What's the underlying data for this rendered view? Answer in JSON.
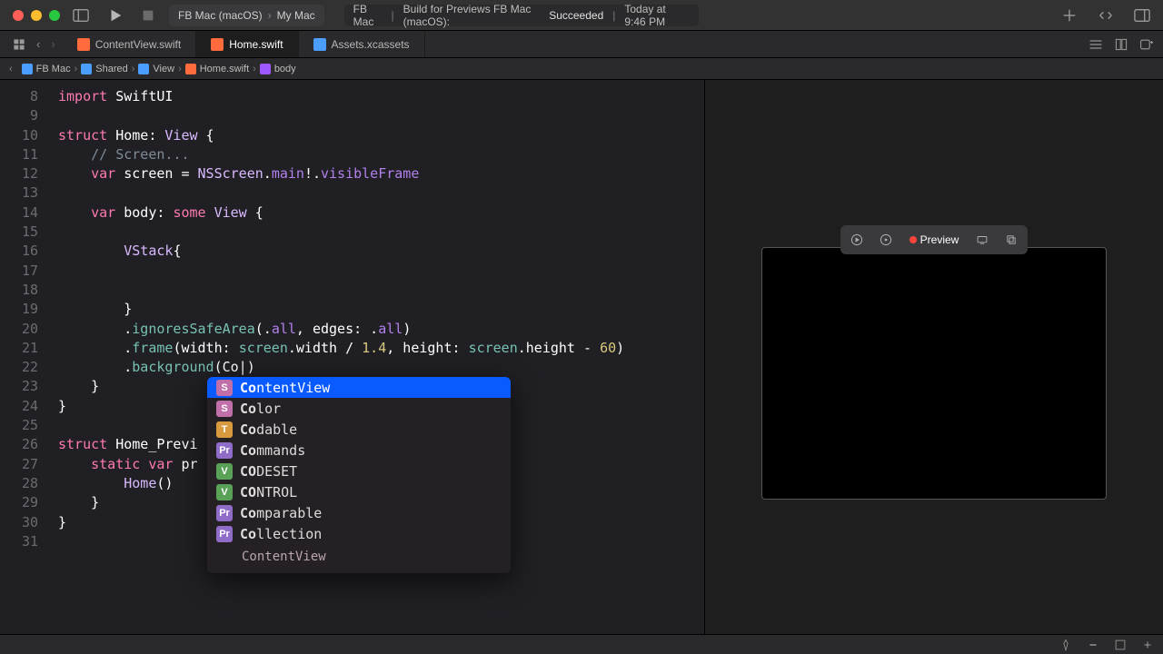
{
  "titlebar": {
    "scheme_target": "FB Mac (macOS)",
    "scheme_device": "My Mac",
    "status_prefix": "FB Mac",
    "status_action": "Build for Previews FB Mac (macOS):",
    "status_result": "Succeeded",
    "status_time": "Today at 9:46 PM"
  },
  "tabs": [
    {
      "label": "ContentView.swift",
      "active": false,
      "kind": "swift"
    },
    {
      "label": "Home.swift",
      "active": true,
      "kind": "swift"
    },
    {
      "label": "Assets.xcassets",
      "active": false,
      "kind": "asset"
    }
  ],
  "breadcrumb": [
    {
      "label": "FB Mac",
      "icon": "proj"
    },
    {
      "label": "Shared",
      "icon": "folder"
    },
    {
      "label": "View",
      "icon": "folder"
    },
    {
      "label": "Home.swift",
      "icon": "file"
    },
    {
      "label": "body",
      "icon": "prop"
    }
  ],
  "editor": {
    "first_line": 8,
    "lines": [
      {
        "t": "import SwiftUI",
        "spans": [
          [
            "import",
            "kw"
          ],
          [
            " ",
            "plain"
          ],
          [
            "SwiftUI",
            "plain"
          ]
        ]
      },
      {
        "t": "",
        "spans": []
      },
      {
        "t": "struct Home: View {",
        "spans": [
          [
            "struct",
            "kw"
          ],
          [
            " Home: ",
            "plain"
          ],
          [
            "View",
            "type"
          ],
          [
            " {",
            "plain"
          ]
        ]
      },
      {
        "t": "    // Screen...",
        "spans": [
          [
            "    ",
            "plain"
          ],
          [
            "// Screen...",
            "cmt"
          ]
        ]
      },
      {
        "t": "    var screen = NSScreen.main!.visibleFrame",
        "spans": [
          [
            "    ",
            "plain"
          ],
          [
            "var",
            "kw"
          ],
          [
            " screen = ",
            "plain"
          ],
          [
            "NSScreen",
            "type"
          ],
          [
            ".",
            "plain"
          ],
          [
            "main",
            "method"
          ],
          [
            "!.",
            "plain"
          ],
          [
            "visibleFrame",
            "method"
          ]
        ]
      },
      {
        "t": "",
        "spans": []
      },
      {
        "t": "    var body: some View {",
        "spans": [
          [
            "    ",
            "plain"
          ],
          [
            "var",
            "kw"
          ],
          [
            " body: ",
            "plain"
          ],
          [
            "some",
            "kw"
          ],
          [
            " ",
            "plain"
          ],
          [
            "View",
            "type"
          ],
          [
            " {",
            "plain"
          ]
        ]
      },
      {
        "t": "",
        "spans": []
      },
      {
        "t": "        VStack{",
        "spans": [
          [
            "        ",
            "plain"
          ],
          [
            "VStack",
            "type"
          ],
          [
            "{",
            "plain"
          ]
        ]
      },
      {
        "t": "",
        "spans": []
      },
      {
        "t": "",
        "spans": []
      },
      {
        "t": "        }",
        "spans": [
          [
            "        }",
            "plain"
          ]
        ]
      },
      {
        "t": "        .ignoresSafeArea(.all, edges: .all)",
        "spans": [
          [
            "        .",
            "plain"
          ],
          [
            "ignoresSafeArea",
            "prop"
          ],
          [
            "(.",
            "plain"
          ],
          [
            "all",
            "method"
          ],
          [
            ", edges: .",
            "plain"
          ],
          [
            "all",
            "method"
          ],
          [
            ")",
            "plain"
          ]
        ]
      },
      {
        "t": "        .frame(width: screen.width / 1.4, height: screen.height - 60)",
        "spans": [
          [
            "        .",
            "plain"
          ],
          [
            "frame",
            "prop"
          ],
          [
            "(width: ",
            "plain"
          ],
          [
            "screen",
            "prop"
          ],
          [
            ".width / ",
            "plain"
          ],
          [
            "1.4",
            "num"
          ],
          [
            ", height: ",
            "plain"
          ],
          [
            "screen",
            "prop"
          ],
          [
            ".height - ",
            "plain"
          ],
          [
            "60",
            "num"
          ],
          [
            ")",
            "plain"
          ]
        ]
      },
      {
        "t": "        .background(Co|)",
        "spans": [
          [
            "        .",
            "plain"
          ],
          [
            "background",
            "prop"
          ],
          [
            "(Co|)",
            "plain"
          ]
        ]
      },
      {
        "t": "    }",
        "spans": [
          [
            "    }",
            "plain"
          ]
        ]
      },
      {
        "t": "}",
        "spans": [
          [
            "}",
            "plain"
          ]
        ]
      },
      {
        "t": "",
        "spans": []
      },
      {
        "t": "struct Home_Previ",
        "spans": [
          [
            "struct",
            "kw"
          ],
          [
            " Home_Previ",
            "plain"
          ]
        ]
      },
      {
        "t": "    static var pr",
        "spans": [
          [
            "    ",
            "plain"
          ],
          [
            "static",
            "kw"
          ],
          [
            " ",
            "plain"
          ],
          [
            "var",
            "kw"
          ],
          [
            " pr",
            "plain"
          ]
        ]
      },
      {
        "t": "        Home()",
        "spans": [
          [
            "        ",
            "plain"
          ],
          [
            "Home",
            "type"
          ],
          [
            "()",
            "plain"
          ]
        ]
      },
      {
        "t": "    }",
        "spans": [
          [
            "    }",
            "plain"
          ]
        ]
      },
      {
        "t": "}",
        "spans": [
          [
            "}",
            "plain"
          ]
        ]
      },
      {
        "t": "",
        "spans": []
      }
    ]
  },
  "autocomplete": {
    "items": [
      {
        "icon": "S",
        "iconClass": "ic-s",
        "prefix": "Co",
        "rest": "ntentView",
        "selected": true
      },
      {
        "icon": "S",
        "iconClass": "ic-s",
        "prefix": "Co",
        "rest": "lor",
        "selected": false
      },
      {
        "icon": "T",
        "iconClass": "ic-t",
        "prefix": "Co",
        "rest": "dable",
        "selected": false
      },
      {
        "icon": "Pr",
        "iconClass": "ic-p",
        "prefix": "Co",
        "rest": "mmands",
        "selected": false
      },
      {
        "icon": "V",
        "iconClass": "ic-v",
        "prefix": "CO",
        "rest": "DESET",
        "selected": false
      },
      {
        "icon": "V",
        "iconClass": "ic-v",
        "prefix": "CO",
        "rest": "NTROL",
        "selected": false
      },
      {
        "icon": "Pr",
        "iconClass": "ic-p",
        "prefix": "Co",
        "rest": "mparable",
        "selected": false
      },
      {
        "icon": "Pr",
        "iconClass": "ic-p",
        "prefix": "Co",
        "rest": "llection",
        "selected": false
      }
    ],
    "doc": "ContentView"
  },
  "preview": {
    "label": "Preview"
  }
}
